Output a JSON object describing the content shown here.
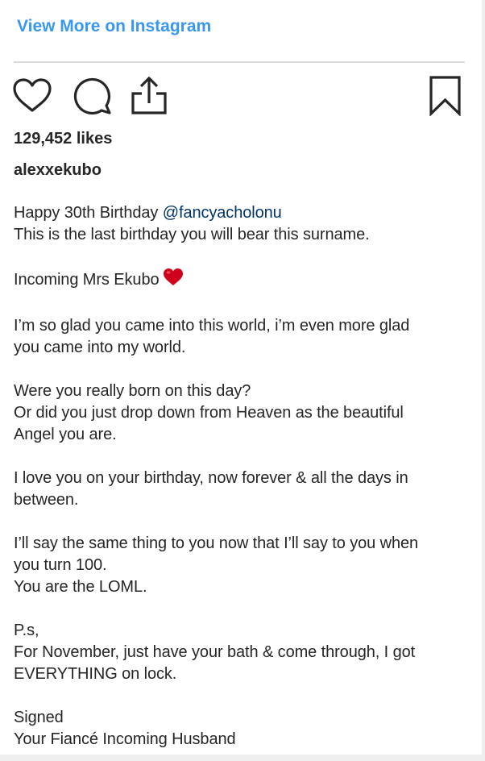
{
  "header": {
    "view_more_label": "View More on Instagram"
  },
  "actions": {
    "like_icon": "heart-outline-icon",
    "comment_icon": "comment-bubble-icon",
    "share_icon": "share-upload-icon",
    "save_icon": "bookmark-icon"
  },
  "post": {
    "likes": "129,452 likes",
    "username": "alexxekubo",
    "caption": {
      "l1_text": "Happy 30th Birthday ",
      "l1_mention": "@fancyacholonu",
      "l2": "This is the last birthday you will bear this surname.",
      "l3_text": "Incoming Mrs Ekubo",
      "l3_emoji": "red-heart-emoji",
      "l4a": "I’m so glad you came into this world, i’m even more glad",
      "l4b": "you came into my world.",
      "l5": "Were you really born on this day?",
      "l6a": "Or did you just drop down from Heaven as the beautiful",
      "l6b": "Angel you are.",
      "l7a": "I love you on your birthday, now forever & all the days in",
      "l7b": "between.",
      "l8a": "I’ll say the same thing to you now that I’ll say to you when",
      "l8b": "you turn 100.",
      "l9": "You are the LOML.",
      "l10": "P.s,",
      "l11a": "For November, just have your bath & come through, I got",
      "l11b": "EVERYTHING on lock.",
      "l12": "Signed",
      "l13": "Your Fiancé Incoming Husband"
    }
  },
  "colors": {
    "link_blue": "#3897f0",
    "mention_blue": "#003569",
    "text": "#262626",
    "divider": "#dbdbdb",
    "heart_red": "#d0021b"
  }
}
